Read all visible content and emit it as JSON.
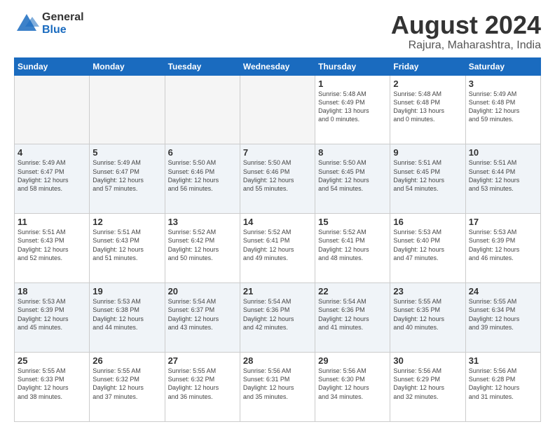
{
  "logo": {
    "line1": "General",
    "line2": "Blue"
  },
  "title": "August 2024",
  "subtitle": "Rajura, Maharashtra, India",
  "days_of_week": [
    "Sunday",
    "Monday",
    "Tuesday",
    "Wednesday",
    "Thursday",
    "Friday",
    "Saturday"
  ],
  "weeks": [
    [
      {
        "day": "",
        "info": "",
        "empty": true
      },
      {
        "day": "",
        "info": "",
        "empty": true
      },
      {
        "day": "",
        "info": "",
        "empty": true
      },
      {
        "day": "",
        "info": "",
        "empty": true
      },
      {
        "day": "1",
        "info": "Sunrise: 5:48 AM\nSunset: 6:49 PM\nDaylight: 13 hours\nand 0 minutes.",
        "empty": false
      },
      {
        "day": "2",
        "info": "Sunrise: 5:48 AM\nSunset: 6:48 PM\nDaylight: 13 hours\nand 0 minutes.",
        "empty": false
      },
      {
        "day": "3",
        "info": "Sunrise: 5:49 AM\nSunset: 6:48 PM\nDaylight: 12 hours\nand 59 minutes.",
        "empty": false
      }
    ],
    [
      {
        "day": "4",
        "info": "Sunrise: 5:49 AM\nSunset: 6:47 PM\nDaylight: 12 hours\nand 58 minutes.",
        "empty": false
      },
      {
        "day": "5",
        "info": "Sunrise: 5:49 AM\nSunset: 6:47 PM\nDaylight: 12 hours\nand 57 minutes.",
        "empty": false
      },
      {
        "day": "6",
        "info": "Sunrise: 5:50 AM\nSunset: 6:46 PM\nDaylight: 12 hours\nand 56 minutes.",
        "empty": false
      },
      {
        "day": "7",
        "info": "Sunrise: 5:50 AM\nSunset: 6:46 PM\nDaylight: 12 hours\nand 55 minutes.",
        "empty": false
      },
      {
        "day": "8",
        "info": "Sunrise: 5:50 AM\nSunset: 6:45 PM\nDaylight: 12 hours\nand 54 minutes.",
        "empty": false
      },
      {
        "day": "9",
        "info": "Sunrise: 5:51 AM\nSunset: 6:45 PM\nDaylight: 12 hours\nand 54 minutes.",
        "empty": false
      },
      {
        "day": "10",
        "info": "Sunrise: 5:51 AM\nSunset: 6:44 PM\nDaylight: 12 hours\nand 53 minutes.",
        "empty": false
      }
    ],
    [
      {
        "day": "11",
        "info": "Sunrise: 5:51 AM\nSunset: 6:43 PM\nDaylight: 12 hours\nand 52 minutes.",
        "empty": false
      },
      {
        "day": "12",
        "info": "Sunrise: 5:51 AM\nSunset: 6:43 PM\nDaylight: 12 hours\nand 51 minutes.",
        "empty": false
      },
      {
        "day": "13",
        "info": "Sunrise: 5:52 AM\nSunset: 6:42 PM\nDaylight: 12 hours\nand 50 minutes.",
        "empty": false
      },
      {
        "day": "14",
        "info": "Sunrise: 5:52 AM\nSunset: 6:41 PM\nDaylight: 12 hours\nand 49 minutes.",
        "empty": false
      },
      {
        "day": "15",
        "info": "Sunrise: 5:52 AM\nSunset: 6:41 PM\nDaylight: 12 hours\nand 48 minutes.",
        "empty": false
      },
      {
        "day": "16",
        "info": "Sunrise: 5:53 AM\nSunset: 6:40 PM\nDaylight: 12 hours\nand 47 minutes.",
        "empty": false
      },
      {
        "day": "17",
        "info": "Sunrise: 5:53 AM\nSunset: 6:39 PM\nDaylight: 12 hours\nand 46 minutes.",
        "empty": false
      }
    ],
    [
      {
        "day": "18",
        "info": "Sunrise: 5:53 AM\nSunset: 6:39 PM\nDaylight: 12 hours\nand 45 minutes.",
        "empty": false
      },
      {
        "day": "19",
        "info": "Sunrise: 5:53 AM\nSunset: 6:38 PM\nDaylight: 12 hours\nand 44 minutes.",
        "empty": false
      },
      {
        "day": "20",
        "info": "Sunrise: 5:54 AM\nSunset: 6:37 PM\nDaylight: 12 hours\nand 43 minutes.",
        "empty": false
      },
      {
        "day": "21",
        "info": "Sunrise: 5:54 AM\nSunset: 6:36 PM\nDaylight: 12 hours\nand 42 minutes.",
        "empty": false
      },
      {
        "day": "22",
        "info": "Sunrise: 5:54 AM\nSunset: 6:36 PM\nDaylight: 12 hours\nand 41 minutes.",
        "empty": false
      },
      {
        "day": "23",
        "info": "Sunrise: 5:55 AM\nSunset: 6:35 PM\nDaylight: 12 hours\nand 40 minutes.",
        "empty": false
      },
      {
        "day": "24",
        "info": "Sunrise: 5:55 AM\nSunset: 6:34 PM\nDaylight: 12 hours\nand 39 minutes.",
        "empty": false
      }
    ],
    [
      {
        "day": "25",
        "info": "Sunrise: 5:55 AM\nSunset: 6:33 PM\nDaylight: 12 hours\nand 38 minutes.",
        "empty": false
      },
      {
        "day": "26",
        "info": "Sunrise: 5:55 AM\nSunset: 6:32 PM\nDaylight: 12 hours\nand 37 minutes.",
        "empty": false
      },
      {
        "day": "27",
        "info": "Sunrise: 5:55 AM\nSunset: 6:32 PM\nDaylight: 12 hours\nand 36 minutes.",
        "empty": false
      },
      {
        "day": "28",
        "info": "Sunrise: 5:56 AM\nSunset: 6:31 PM\nDaylight: 12 hours\nand 35 minutes.",
        "empty": false
      },
      {
        "day": "29",
        "info": "Sunrise: 5:56 AM\nSunset: 6:30 PM\nDaylight: 12 hours\nand 34 minutes.",
        "empty": false
      },
      {
        "day": "30",
        "info": "Sunrise: 5:56 AM\nSunset: 6:29 PM\nDaylight: 12 hours\nand 32 minutes.",
        "empty": false
      },
      {
        "day": "31",
        "info": "Sunrise: 5:56 AM\nSunset: 6:28 PM\nDaylight: 12 hours\nand 31 minutes.",
        "empty": false
      }
    ]
  ],
  "colors": {
    "header_bg": "#1a6bbf",
    "shaded_row": "#f0f4f8",
    "empty_cell": "#f5f5f5"
  }
}
